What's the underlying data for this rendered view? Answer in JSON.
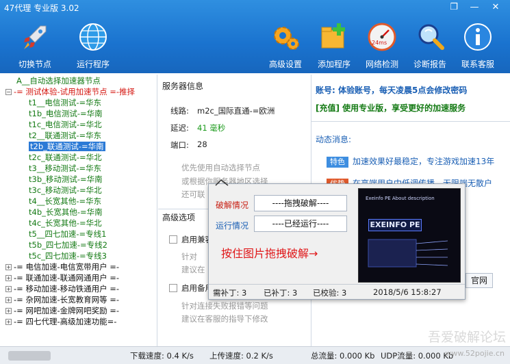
{
  "window": {
    "title": "47代理 专业版 3.02"
  },
  "toolbar": {
    "switch_node": "切换节点",
    "run_program": "运行程序",
    "advanced_settings": "高级设置",
    "add_program": "添加程序",
    "network_check": "网络检测",
    "network_check_ms": "24ms",
    "diagnose_report": "诊断报告",
    "contact_support": "联系客服"
  },
  "tree": {
    "auto_select": "A__自动选择加速器节点",
    "group_trial": "-= 测试体验-试用加速节点 =-推择",
    "trial_nodes": [
      "t1__电信测试-=华东",
      "t1b_电信测试-=华南",
      "t1c_电信测试-=华北",
      "t2__联通测试-=华东",
      "t2b_联通测试-=华南",
      "t2c_联通测试-=华北",
      "t3__移动测试-=华东",
      "t3b_移动测试-=华南",
      "t3c_移动测试-=华北",
      "t4__长宽其他-=华东",
      "t4b_长宽其他-=华南",
      "t4c_长宽其他-=华北",
      "t5__四七加速-=专线1",
      "t5b_四七加速-=专线2",
      "t5c_四七加速-=专线3"
    ],
    "groups": [
      "-= 电信加速-电信宽带用户 =-",
      "-= 联通加速-联通网通用户 =-",
      "-= 移动加速-移动铁通用户 =-",
      "-= 杂网加速-长宽教育网等 =-",
      "-= 网吧加速-金牌网吧奖励 =-",
      "-= 四七代理-高级加速功能=-"
    ]
  },
  "server_info": {
    "section_title": "服务器信息",
    "line_label": "线路:",
    "line_value": "m2c_国际直通-=欧洲",
    "latency_label": "延迟:",
    "latency_value": "41 毫秒",
    "port_label": "端口:",
    "port_value": "28",
    "tip1": "优先使用自动选择节点",
    "tip2": "或根据你服务器地区选择",
    "tip3": "还可联"
  },
  "advanced": {
    "section_title": "高级选项",
    "opt1_label": "启用兼容",
    "opt1_hint1": "针对",
    "opt1_hint2": "建议在",
    "opt2_label": "启用备用",
    "opt2_hint1": "针对连接失败报错等问题",
    "opt2_hint2": "建议在客服的指导下修改"
  },
  "account": {
    "line1": "账号: 体验账号，每天凌晨5点会修改密码",
    "line2": "[充值] 使用专业版，享受更好的加速服务",
    "news_title": "动态消息:",
    "news1_tag": "特色",
    "news1_text": "加速效果好最稳定，专注游戏加速13年",
    "news2_tag": "优势",
    "news2_text": "在高端用户中低调传播，无限端无散户",
    "official_site": "官网"
  },
  "popup": {
    "crack_label": "破解情况",
    "crack_value": "----拖拽破解----",
    "run_label": "运行情况",
    "run_value": "----已经运行----",
    "drag_hint": "按住图片拖拽破解→",
    "exe_title": "Exeinfo PE    About description",
    "exe_logo": "EXEINFO PE",
    "need_patch": "需补丁: 3",
    "patched": "已补丁: 3",
    "verified": "已校验: 3",
    "datetime": "2018/5/6 15:8:27"
  },
  "statusbar": {
    "download": "下载速度: 0.4 K/s",
    "upload": "上传速度: 0.2 K/s",
    "total": "总流量: 0.000 Kb",
    "udp": "UDP流量: 0.000 Kb"
  },
  "watermark": {
    "text": "吾爱破解论坛",
    "url": "www.52pojie.cn"
  },
  "colors": {
    "accent": "#1a73cf",
    "tree_green": "#147a14",
    "tree_red": "#d4140e",
    "selection": "#2b7ad6",
    "news_tag1": "#3e8ee0",
    "news_tag2": "#e05a2c"
  }
}
